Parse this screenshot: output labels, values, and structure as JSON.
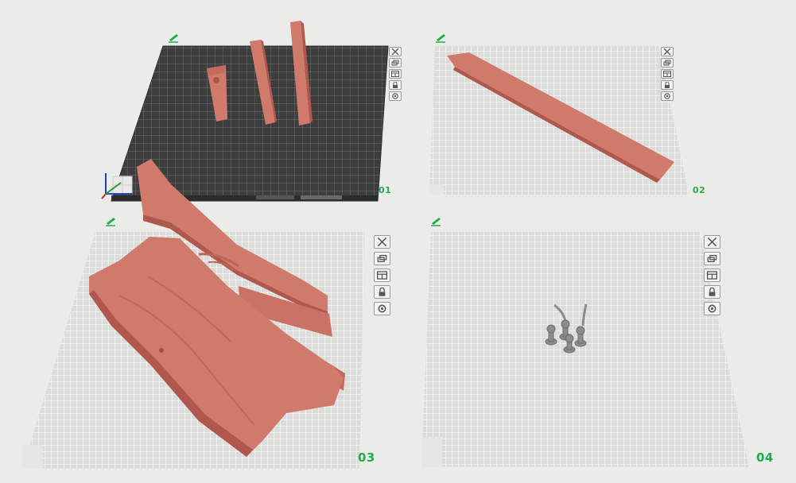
{
  "plates": [
    {
      "id": "plate-1",
      "label": "01",
      "surface": "textured-dark"
    },
    {
      "id": "plate-2",
      "label": "02",
      "surface": "light-grid"
    },
    {
      "id": "plate-3",
      "label": "03",
      "surface": "light-grid"
    },
    {
      "id": "plate-4",
      "label": "04",
      "surface": "light-grid"
    }
  ],
  "plate_tools": [
    {
      "name": "close-plate-button",
      "icon": "close-x-icon"
    },
    {
      "name": "auto-orient-button",
      "icon": "orient-icon"
    },
    {
      "name": "arrange-button",
      "icon": "arrange-icon"
    },
    {
      "name": "lock-plate-button",
      "icon": "lock-icon"
    },
    {
      "name": "plate-settings-button",
      "icon": "settings-gear-icon"
    }
  ],
  "colors": {
    "background": "#ebebea",
    "plate_light": "#dcdcdb",
    "plate_grid": "#ffffff",
    "plate_dark": "#3e3e3e",
    "model": "#d07a6c",
    "model_shadow": "#b0584d",
    "hardware": "#8c8c8c",
    "label_green": "#1fae4b",
    "edit_green": "#1fae4b"
  }
}
